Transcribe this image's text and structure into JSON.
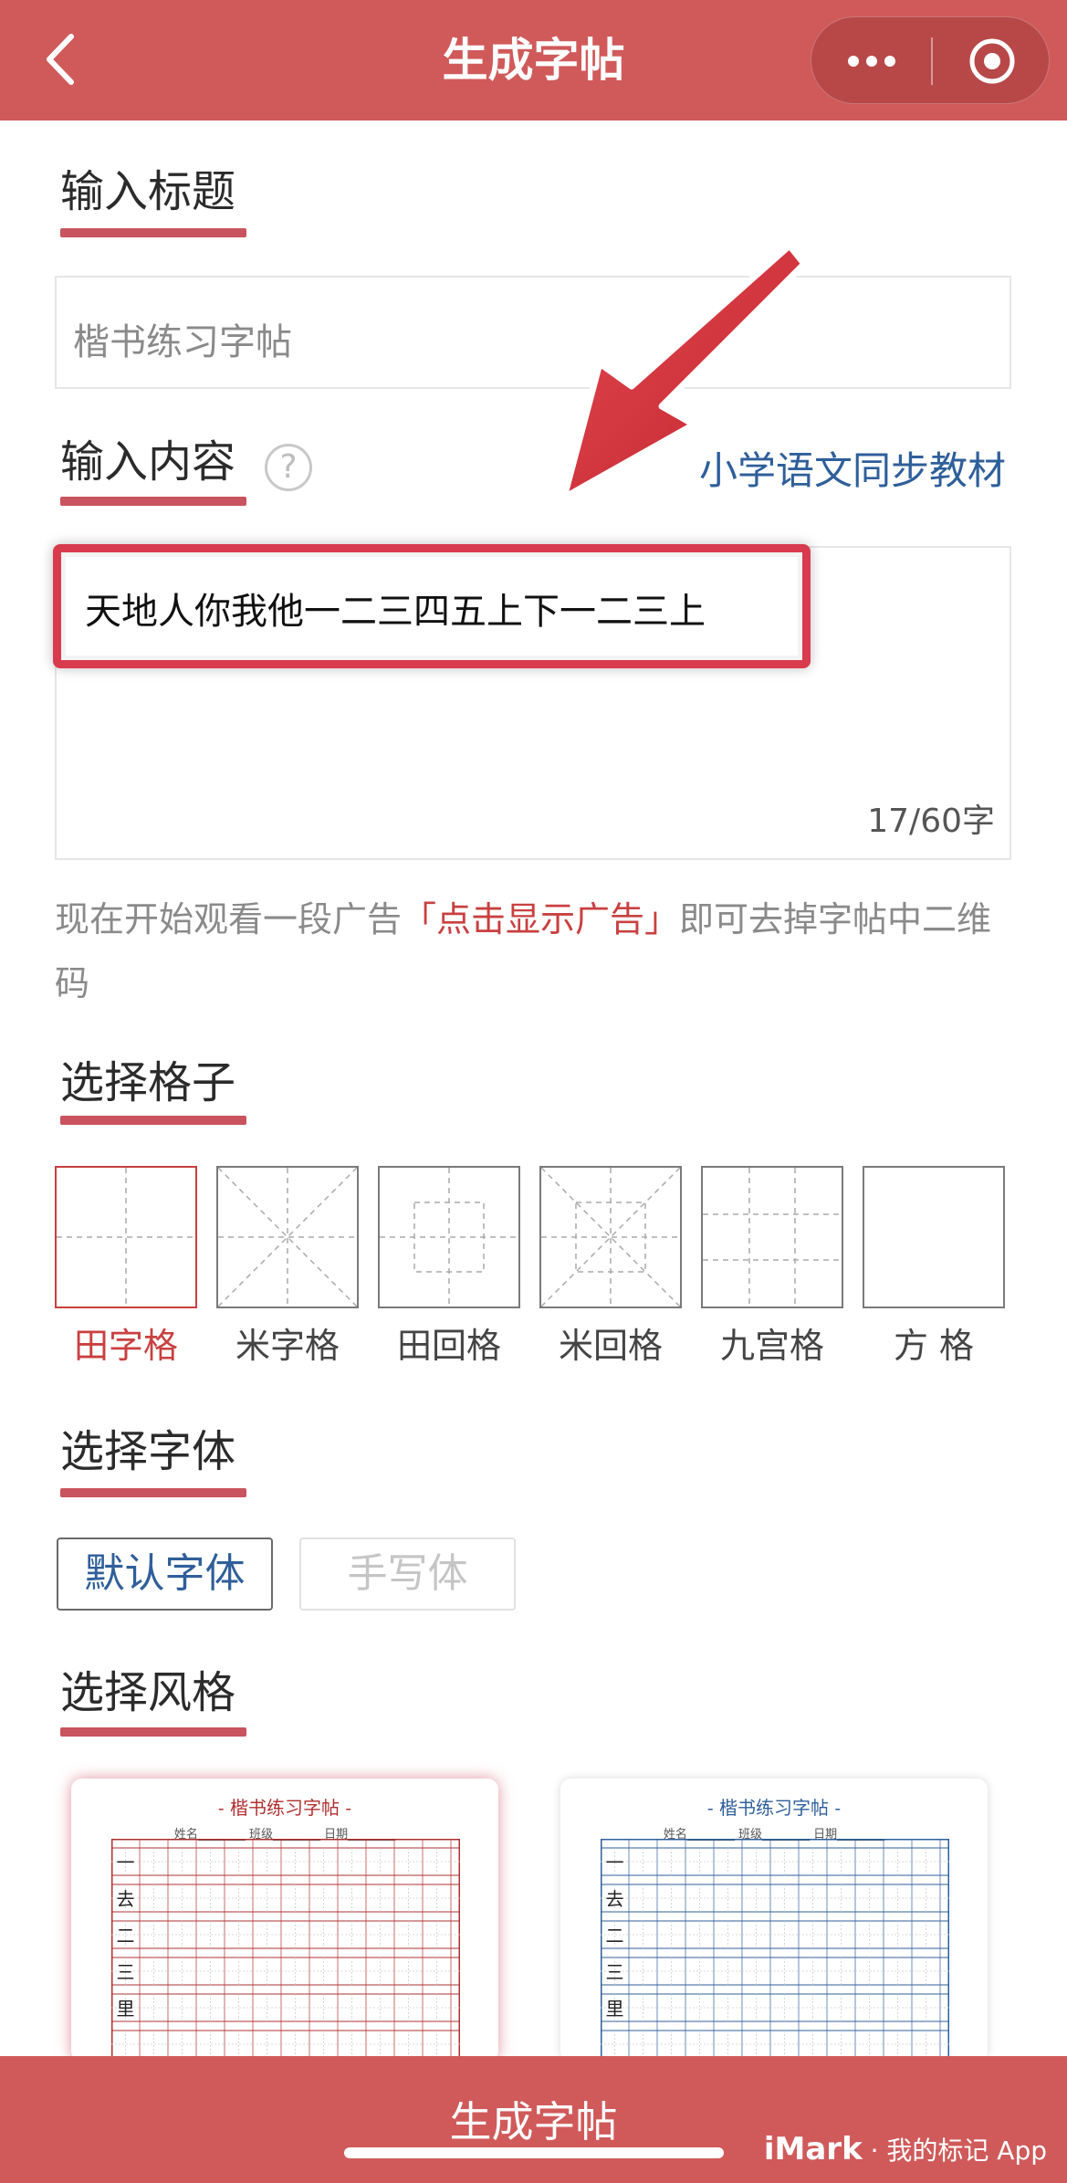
{
  "nav": {
    "title": "生成字帖"
  },
  "title_section": {
    "heading": "输入标题",
    "placeholder": "楷书练习字帖"
  },
  "content_section": {
    "heading": "输入内容",
    "help": "?",
    "link": "小学语文同步教材",
    "text": "天地人你我他一二三四五上下一二三上",
    "counter": "17/60字"
  },
  "ad_notice": {
    "prefix": "现在开始观看一段广告",
    "link": "「点击显示广告」",
    "suffix": "即可去掉字帖中二维码"
  },
  "grid_section": {
    "heading": "选择格子",
    "options": [
      {
        "label": "田字格",
        "type": "tian",
        "selected": true
      },
      {
        "label": "米字格",
        "type": "mi",
        "selected": false
      },
      {
        "label": "田回格",
        "type": "tianhui",
        "selected": false
      },
      {
        "label": "米回格",
        "type": "mihui",
        "selected": false
      },
      {
        "label": "九宫格",
        "type": "jiugong",
        "selected": false
      },
      {
        "label": "方 格",
        "type": "fang",
        "selected": false
      }
    ]
  },
  "font_section": {
    "heading": "选择字体",
    "options": [
      {
        "label": "默认字体",
        "selected": true
      },
      {
        "label": "手写体",
        "selected": false
      }
    ]
  },
  "style_section": {
    "heading": "选择风格",
    "cards": [
      {
        "title": "- 楷书练习字帖 -",
        "info": "姓名________ 班级________ 日期________",
        "color": "#b03030",
        "selected": true
      },
      {
        "title": "- 楷书练习字帖 -",
        "info": "姓名________ 班级________ 日期________",
        "color": "#2f5f9a",
        "selected": false
      }
    ],
    "sample_chars": [
      "一",
      "去",
      "二",
      "三",
      "里"
    ]
  },
  "bottom": {
    "label": "生成字帖"
  },
  "watermark": {
    "brand": "iMark",
    "text": " · 我的标记 App"
  },
  "colors": {
    "primary": "#d05a5a",
    "accent_red": "#c94040",
    "link_blue": "#2f5f9a"
  }
}
